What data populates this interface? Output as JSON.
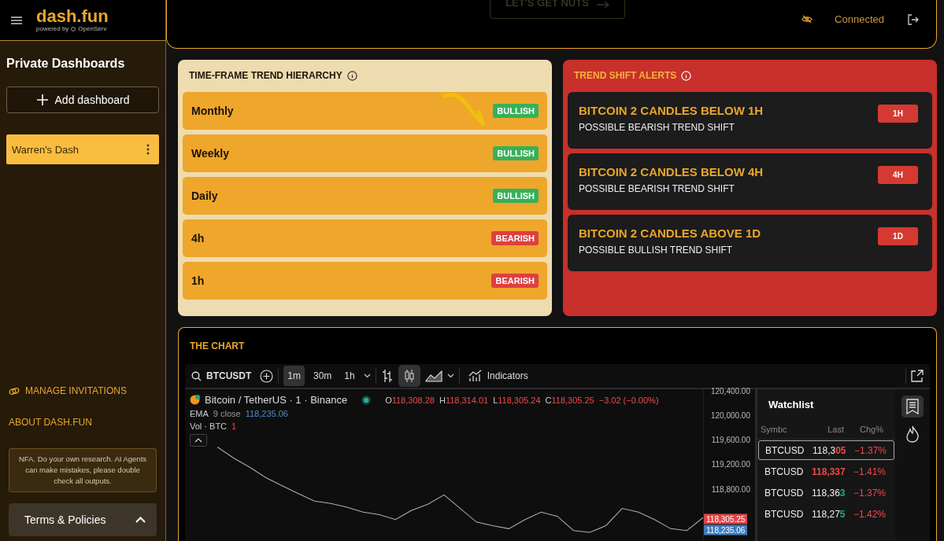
{
  "header": {
    "logo": "dash.fun",
    "tagline": "powered by",
    "partner": "OpenServ",
    "cta": "LET'S GET NUTS",
    "status": "Connected"
  },
  "sidebar": {
    "title": "Private Dashboards",
    "add_button": "Add dashboard",
    "dashboards": [
      {
        "label": "Warren's Dash",
        "selected": true
      }
    ],
    "links": [
      {
        "label": "MANAGE INVITATIONS",
        "kind": "icon"
      },
      {
        "label": "ABOUT DASH.FUN",
        "kind": "plain"
      }
    ],
    "disclaimer": "NFA. Do your own research. AI Agents can make mistakes, please double check all outputs.",
    "terms": {
      "label": "Terms & Policies",
      "expanded": true
    }
  },
  "hierarchy": {
    "title": "TIME-FRAME TREND HIERARCHY",
    "rows": [
      {
        "label": "Monthly",
        "trend": "BULLISH",
        "kind": "bullish"
      },
      {
        "label": "Weekly",
        "trend": "BULLISH",
        "kind": "bullish"
      },
      {
        "label": "Daily",
        "trend": "BULLISH",
        "kind": "bullish"
      },
      {
        "label": "4h",
        "trend": "BEARISH",
        "kind": "bearish"
      },
      {
        "label": "1h",
        "trend": "BEARISH",
        "kind": "bearish"
      }
    ]
  },
  "alerts": {
    "title": "TREND SHIFT ALERTS",
    "items": [
      {
        "title": "BITCOIN 2 CANDLES BELOW 1H",
        "subtitle": "POSSIBLE BEARISH TREND SHIFT",
        "tag": "1H"
      },
      {
        "title": "BITCOIN 2 CANDLES BELOW 4H",
        "subtitle": "POSSIBLE BEARISH TREND SHIFT",
        "tag": "4H"
      },
      {
        "title": "BITCOIN 2 CANDLES ABOVE 1D",
        "subtitle": "POSSIBLE BULLISH TREND SHIFT",
        "tag": "1D"
      }
    ]
  },
  "chart_panel": {
    "title": "THE CHART",
    "toolbar": {
      "symbol": "BTCUSDT",
      "intervals": [
        {
          "label": "1m",
          "selected": true
        },
        {
          "label": "30m",
          "selected": false
        },
        {
          "label": "1h",
          "selected": false
        }
      ],
      "indicators": "Indicators"
    },
    "legend": {
      "name": "Bitcoin / TetherUS · 1 · Binance",
      "ohlc": [
        {
          "key": "O",
          "value": "118,308.28"
        },
        {
          "key": "H",
          "value": "118,314.01"
        },
        {
          "key": "L",
          "value": "118,305.24"
        },
        {
          "key": "C",
          "value": "118,305.25"
        }
      ],
      "change": "−3.02 (−0.00%)",
      "ema_label": "EMA",
      "ema_params": "9 close",
      "ema_value": "118,235.06",
      "vol_label": "Vol · BTC",
      "vol_value": "1"
    },
    "chart_data": {
      "type": "line",
      "ylim": [
        117950,
        120420
      ],
      "yticks": [
        {
          "value": 120400,
          "label": "120,400.00"
        },
        {
          "value": 120000,
          "label": "120,000.00"
        },
        {
          "value": 119600,
          "label": "119,600.00"
        },
        {
          "value": 119200,
          "label": "119,200.00"
        },
        {
          "value": 118800,
          "label": "118,800.00"
        }
      ],
      "series": [
        {
          "color": "#b0b0b0",
          "values": [
            null,
            null,
            119480,
            119300,
            119150,
            118980,
            118850,
            118720,
            118600,
            118560,
            118500,
            118420,
            118380,
            118300,
            118450,
            118550,
            118700,
            118480,
            118260,
            118200,
            118150,
            118300,
            118420,
            118350,
            118120,
            118090,
            118200,
            118480,
            118420,
            118300,
            118150,
            118120,
            118330
          ]
        }
      ]
    },
    "price_tags": [
      {
        "value": "118,305.25",
        "kind": "last"
      },
      {
        "value": "118,235.06",
        "kind": "ema"
      }
    ],
    "watchlist": {
      "title": "Watchlist",
      "columns": [
        "Symbc",
        "Last",
        "Chg%"
      ],
      "rows": [
        {
          "symbol": "BTCUSD",
          "last_base": "118,3",
          "last_tick": "05",
          "color": "#f04a4a",
          "change": "−1.37%",
          "selected": true
        },
        {
          "symbol": "BTCUSD",
          "last_base": "",
          "last_tick": "118,337",
          "color": "#f04a4a",
          "change": "−1.41%",
          "selected": false
        },
        {
          "symbol": "BTCUSD",
          "last_base": "118,36",
          "last_tick": "3",
          "color": "#22ab94",
          "change": "−1.37%",
          "selected": false
        },
        {
          "symbol": "BTCUSD",
          "last_base": "118,27",
          "last_tick": "5",
          "color": "#22ab94",
          "change": "−1.42%",
          "selected": false
        }
      ]
    }
  }
}
